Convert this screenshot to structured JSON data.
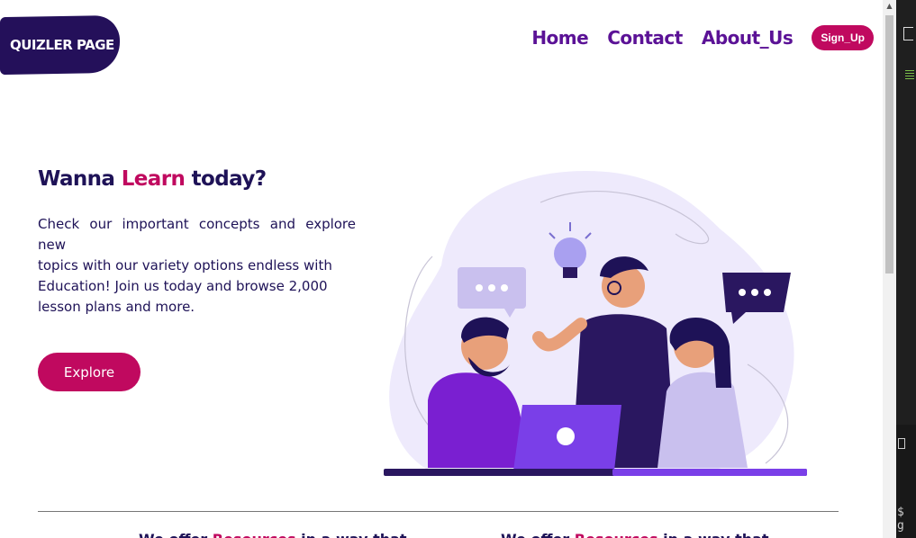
{
  "logo": {
    "text": "QUIZLER PAGE"
  },
  "nav": {
    "home": "Home",
    "contact": "Contact",
    "about": "About_Us",
    "signup": "Sign_Up"
  },
  "hero": {
    "title_before": "Wanna ",
    "title_accent": "Learn",
    "title_after": " today?",
    "desc_line1": "Check our important concepts and explore",
    "desc_line2": "new",
    "desc_line3": "topics with our variety options endless with",
    "desc_line4": "Education! Join us today and browse 2,000",
    "desc_line5": "lesson plans and more.",
    "explore_label": "Explore"
  },
  "colors": {
    "accent": "#c0095f",
    "primary_dark": "#1e1257",
    "nav_purple": "#5b1296",
    "logo_bg": "#24105a"
  },
  "bottom": {
    "left_heading_before": "We offer ",
    "left_heading_accent": "Resources",
    "left_heading_after": " in a way that",
    "right_heading_before": "We offer ",
    "right_heading_accent": "Resources",
    "right_heading_after": " in a way that"
  },
  "editor": {
    "prompt": "$ g"
  }
}
